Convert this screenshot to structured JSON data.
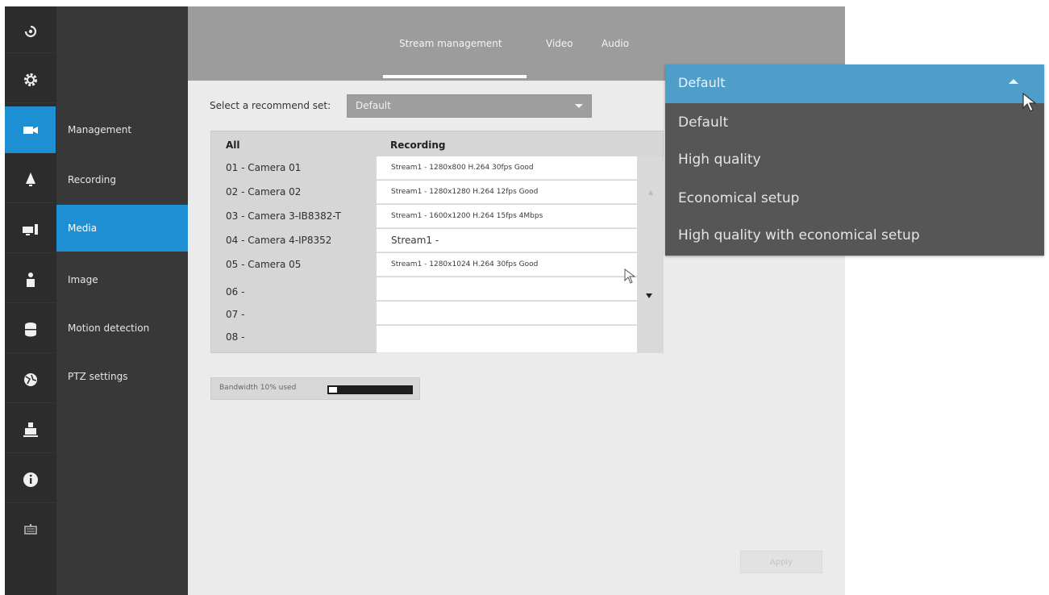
{
  "sidebar": {
    "menu_items": [
      {
        "label": "Management"
      },
      {
        "label": "Recording"
      },
      {
        "label": "Media"
      },
      {
        "label": "Image"
      },
      {
        "label": "Motion detection"
      },
      {
        "label": "PTZ settings"
      }
    ],
    "active_item": "Media"
  },
  "rail": {
    "icons": [
      "logo-icon",
      "gear-icon",
      "camera-icon",
      "alarm-icon",
      "monitor-icon",
      "user-icon",
      "database-icon",
      "network-icon",
      "storage-icon",
      "info-icon",
      "keyboard-icon"
    ],
    "active_icon": "camera-icon"
  },
  "header": {
    "tabs": [
      {
        "label": "Stream management"
      },
      {
        "label": "Video"
      },
      {
        "label": "Audio"
      }
    ],
    "active_tab": "Stream management"
  },
  "recommend_set": {
    "label": "Select a recommend set:",
    "value": "Default"
  },
  "table": {
    "headers": [
      "All",
      "Recording"
    ],
    "rows": [
      {
        "camera": "01 - Camera 01",
        "stream": "Stream1 - 1280x800 H.264 30fps Good"
      },
      {
        "camera": "02 - Camera 02",
        "stream": "Stream1 - 1280x1280 H.264 12fps Good"
      },
      {
        "camera": "03 - Camera 3-IB8382-T",
        "stream": "Stream1 - 1600x1200 H.264 15fps 4Mbps"
      },
      {
        "camera": "04 - Camera 4-IP8352",
        "stream": "Stream1 -"
      },
      {
        "camera": "05 - Camera 05",
        "stream": "Stream1 - 1280x1024 H.264 30fps Good"
      },
      {
        "camera": "06 -",
        "stream": ""
      },
      {
        "camera": "07 -",
        "stream": ""
      },
      {
        "camera": "08 -",
        "stream": ""
      }
    ]
  },
  "bandwidth": {
    "label": "Bandwidth 10% used",
    "used_fraction": 0.1
  },
  "apply_label": "Apply",
  "dropdown": {
    "selected": "Default",
    "options": [
      "Default",
      "High quality",
      "Economical setup",
      "High quality with economical setup"
    ]
  },
  "colors": {
    "accent": "#1f8fd3",
    "dropdown_highlight": "#4f9dc9",
    "rail_bg": "#2c2c2c",
    "menu_bg": "#383838",
    "topbar_bg": "#9c9c9c",
    "content_bg": "#ebebeb",
    "dropdown_bg": "#565656"
  }
}
